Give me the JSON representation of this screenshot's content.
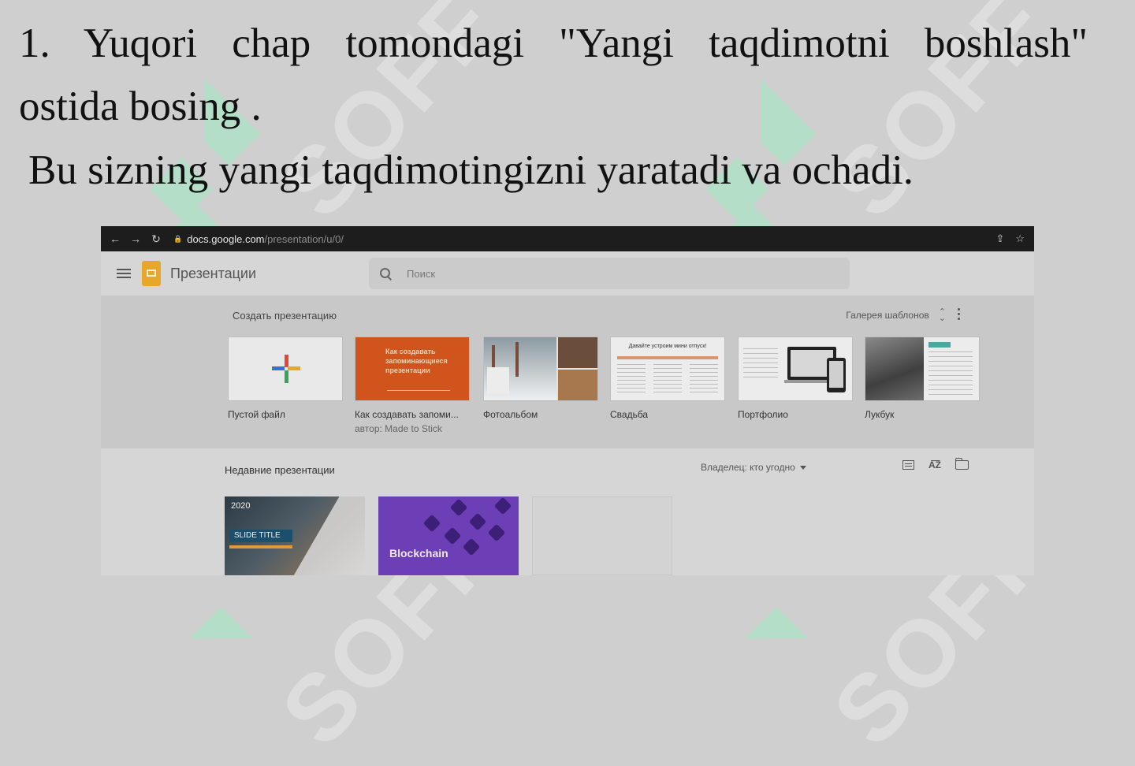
{
  "instructions": {
    "line1": "1. Yuqori chap tomondagi \"Yangi taqdimotni boshlash\"",
    "line2": "ostida bosing .",
    "line3": "Bu sizning yangi taqdimotingizni yaratadi va ochadi."
  },
  "watermark": {
    "text": "SOFF",
    "color": "#a8e6c4"
  },
  "browser": {
    "url_host": "docs.google.com",
    "url_path": "/presentation/u/0/"
  },
  "app": {
    "title": "Презентации",
    "search_placeholder": "Поиск"
  },
  "templates": {
    "heading": "Создать презентацию",
    "gallery_label": "Галерея шаблонов",
    "items": [
      {
        "label": "Пустой файл",
        "sub": ""
      },
      {
        "label": "Как создавать запоми...",
        "sub": "автор: Made to Stick",
        "thumb_text": "Как создавать запоминающиеся презентации"
      },
      {
        "label": "Фотоальбом",
        "sub": ""
      },
      {
        "label": "Свадьба",
        "sub": "",
        "thumb_text": "Давайте устроим мини отпуск!"
      },
      {
        "label": "Портфолио",
        "sub": ""
      },
      {
        "label": "Лукбук",
        "sub": ""
      }
    ]
  },
  "recent": {
    "heading": "Недавние презентации",
    "owner_filter": "Владелец: кто угодно",
    "docs": [
      {
        "year": "2020",
        "slide_title": "SLIDE TITLE"
      },
      {
        "title": "Blockchain"
      },
      {
        "title": ""
      }
    ]
  },
  "colors": {
    "slides_brand": "#e8a72a",
    "template_orange": "#d2541d",
    "blockchain_purple": "#6c3fb7"
  }
}
